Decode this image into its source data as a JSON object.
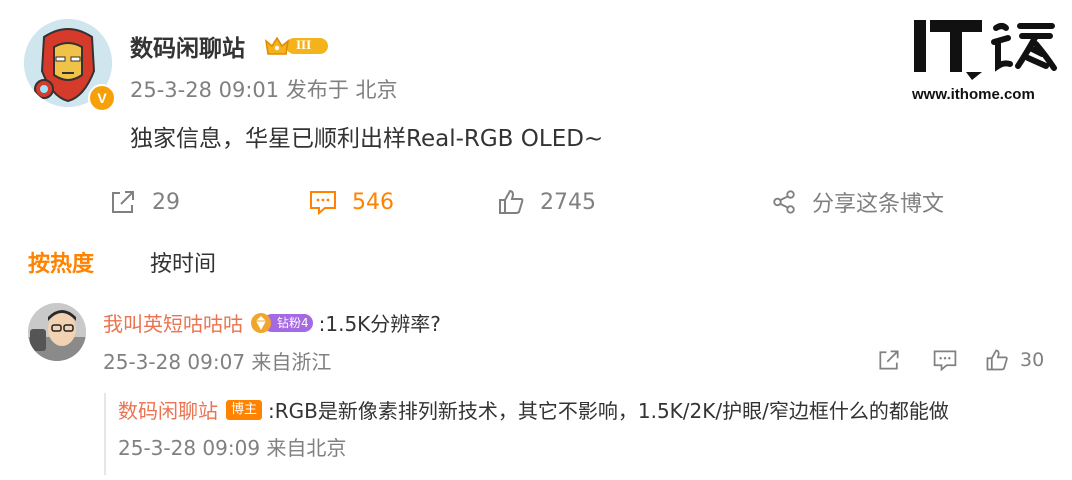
{
  "post": {
    "author": "数码闲聊站",
    "rank_badge": "III",
    "verified_badge": "V",
    "meta": "25-3-28 09:01 发布于 北京",
    "text": "独家信息，华星已顺利出样Real-RGB OLED~"
  },
  "actions": {
    "repost_count": "29",
    "comment_count": "546",
    "like_count": "2745",
    "share_label": "分享这条博文"
  },
  "sort": {
    "hot": "按热度",
    "time": "按时间"
  },
  "comment": {
    "user": "我叫英短咕咕咕",
    "fan_badge": "钻粉4",
    "text": ":1.5K分辨率?",
    "meta": "25-3-28 09:07 来自浙江",
    "like_count": "30"
  },
  "reply": {
    "user": "数码闲聊站",
    "host_badge": "博主",
    "text": ":RGB是新像素排列新技术，其它不影响，1.5K/2K/护眼/窄边框什么的都能做",
    "meta": "25-3-28 09:09 来自北京"
  },
  "watermark": {
    "url": "www.ithome.com"
  },
  "colors": {
    "accent": "#ff8200",
    "nickname": "#eb7350",
    "muted": "#808080",
    "fan_badge": "#a469e3"
  }
}
